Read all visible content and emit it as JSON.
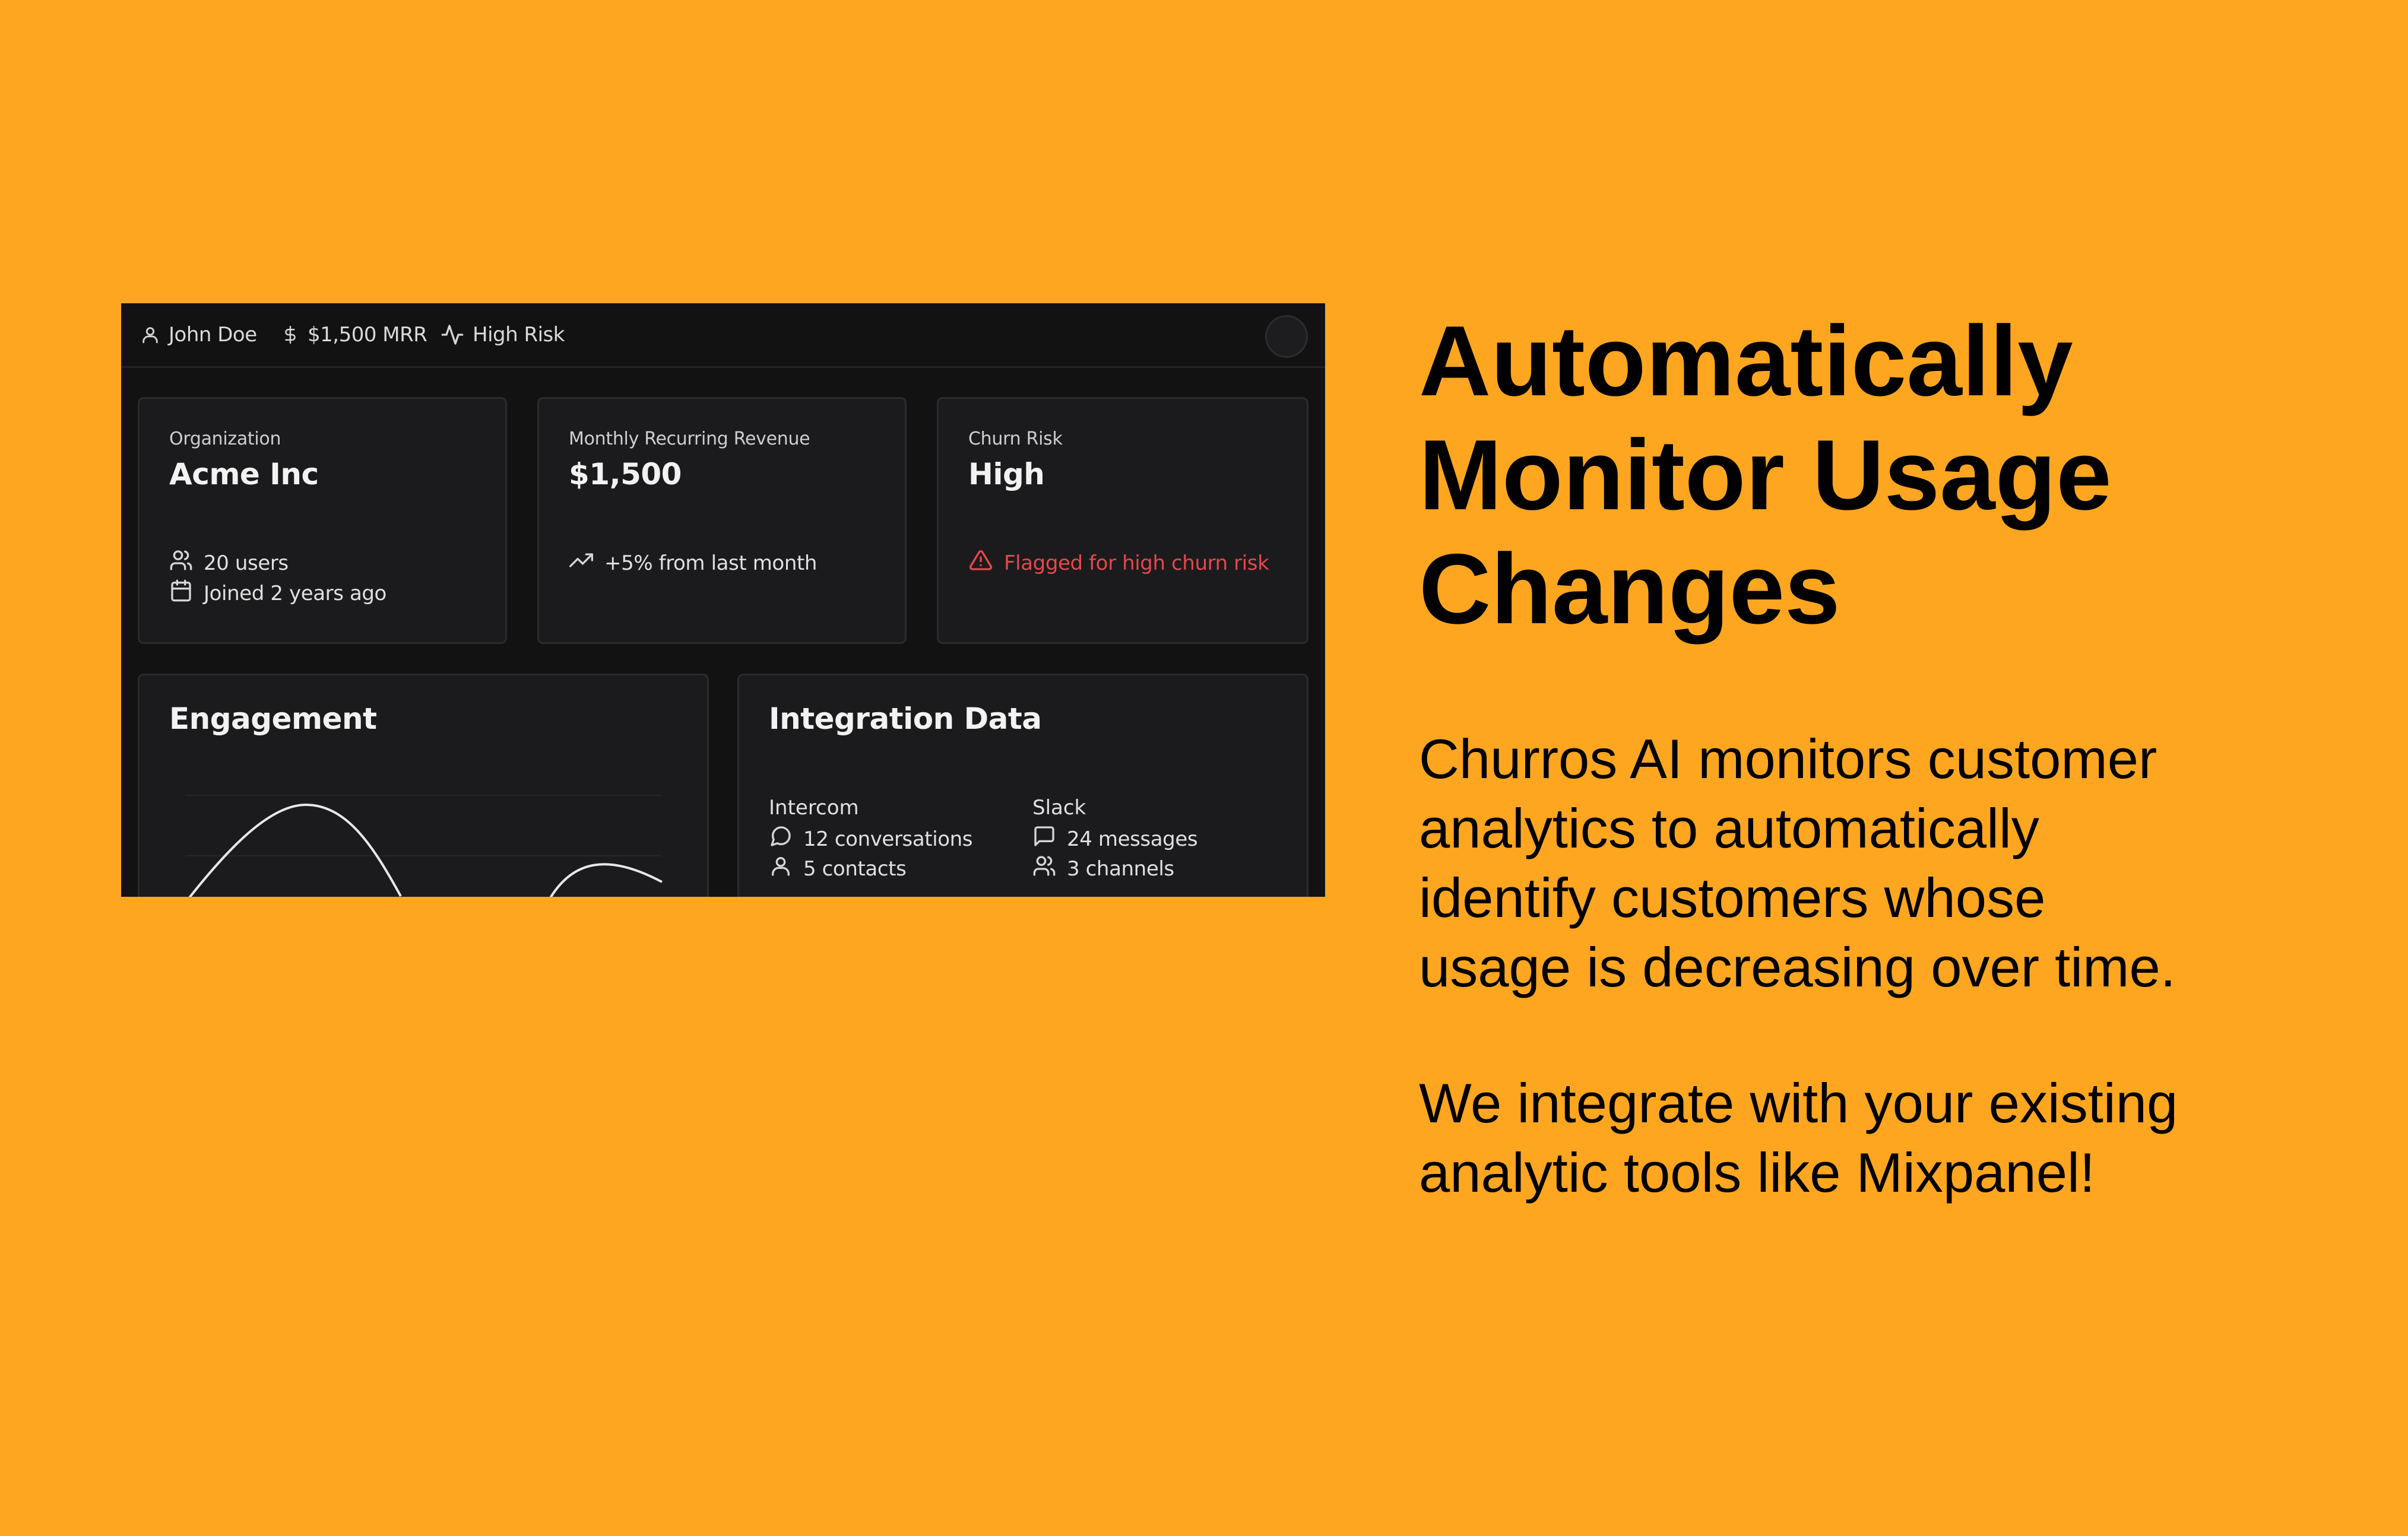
{
  "dashboard": {
    "topbar": {
      "user": {
        "icon": "user-icon",
        "label": "John Doe"
      },
      "mrr": {
        "icon": "dollar-icon",
        "label": "$1,500 MRR"
      },
      "risk": {
        "icon": "activity-icon",
        "label": "High Risk"
      }
    },
    "cards": {
      "organization": {
        "label": "Organization",
        "value": "Acme Inc",
        "users": {
          "icon": "users-icon",
          "text": "20 users"
        },
        "joined": {
          "icon": "calendar-icon",
          "text": "Joined 2 years ago"
        }
      },
      "mrr": {
        "label": "Monthly Recurring Revenue",
        "value": "$1,500",
        "trend": {
          "icon": "trending-up-icon",
          "text": "+5% from last month"
        }
      },
      "churn": {
        "label": "Churn Risk",
        "value": "High",
        "flag": {
          "icon": "alert-triangle-icon",
          "text": "Flagged for high churn risk",
          "color": "#e5484d"
        }
      }
    },
    "engagement": {
      "title": "Engagement"
    },
    "integration": {
      "title": "Integration Data",
      "intercom": {
        "name": "Intercom",
        "conversations": {
          "icon": "message-circle-icon",
          "text": "12 conversations"
        },
        "contacts": {
          "icon": "user-icon",
          "text": "5 contacts"
        }
      },
      "slack": {
        "name": "Slack",
        "messages": {
          "icon": "message-square-icon",
          "text": "24 messages"
        },
        "channels": {
          "icon": "users-icon",
          "text": "3 channels"
        }
      }
    }
  },
  "copy": {
    "headline_line1": "Automatically",
    "headline_line2": "Monitor Usage",
    "headline_line3": "Changes",
    "para1_line1": "Churros AI monitors customer",
    "para1_line2": "analytics to automatically",
    "para1_line3": "identify customers whose",
    "para1_line4": "usage is decreasing over time.",
    "para2_line1": "We integrate with your existing",
    "para2_line2": "analytic tools like Mixpanel!"
  },
  "colors": {
    "background": "#FFA620",
    "panel": "#121213",
    "card": "#1b1b1d",
    "alert": "#e5484d"
  }
}
